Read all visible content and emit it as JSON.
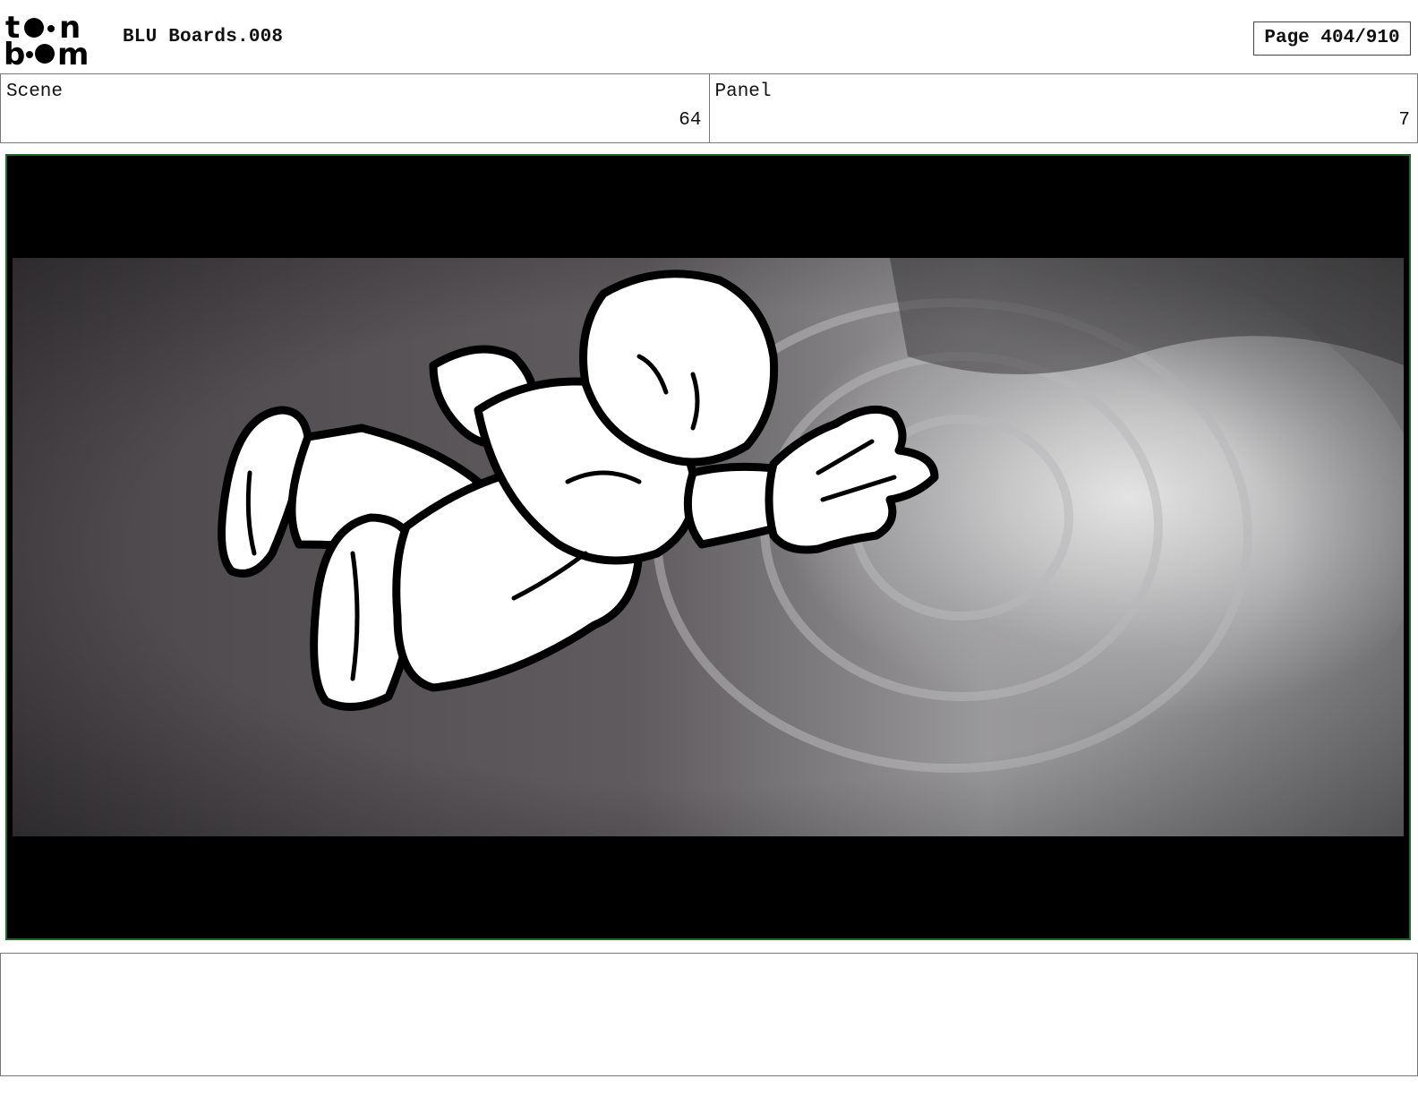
{
  "header": {
    "logo_text_top": "to•n",
    "logo_text_bottom": "b••m",
    "title": "BLU Boards.008",
    "page": "Page 404/910"
  },
  "info": {
    "scene_label": "Scene",
    "scene_value": "64",
    "panel_label": "Panel",
    "panel_value": "7"
  },
  "colors": {
    "frame_border": "#1f6b2a",
    "letterbox": "#000000"
  }
}
